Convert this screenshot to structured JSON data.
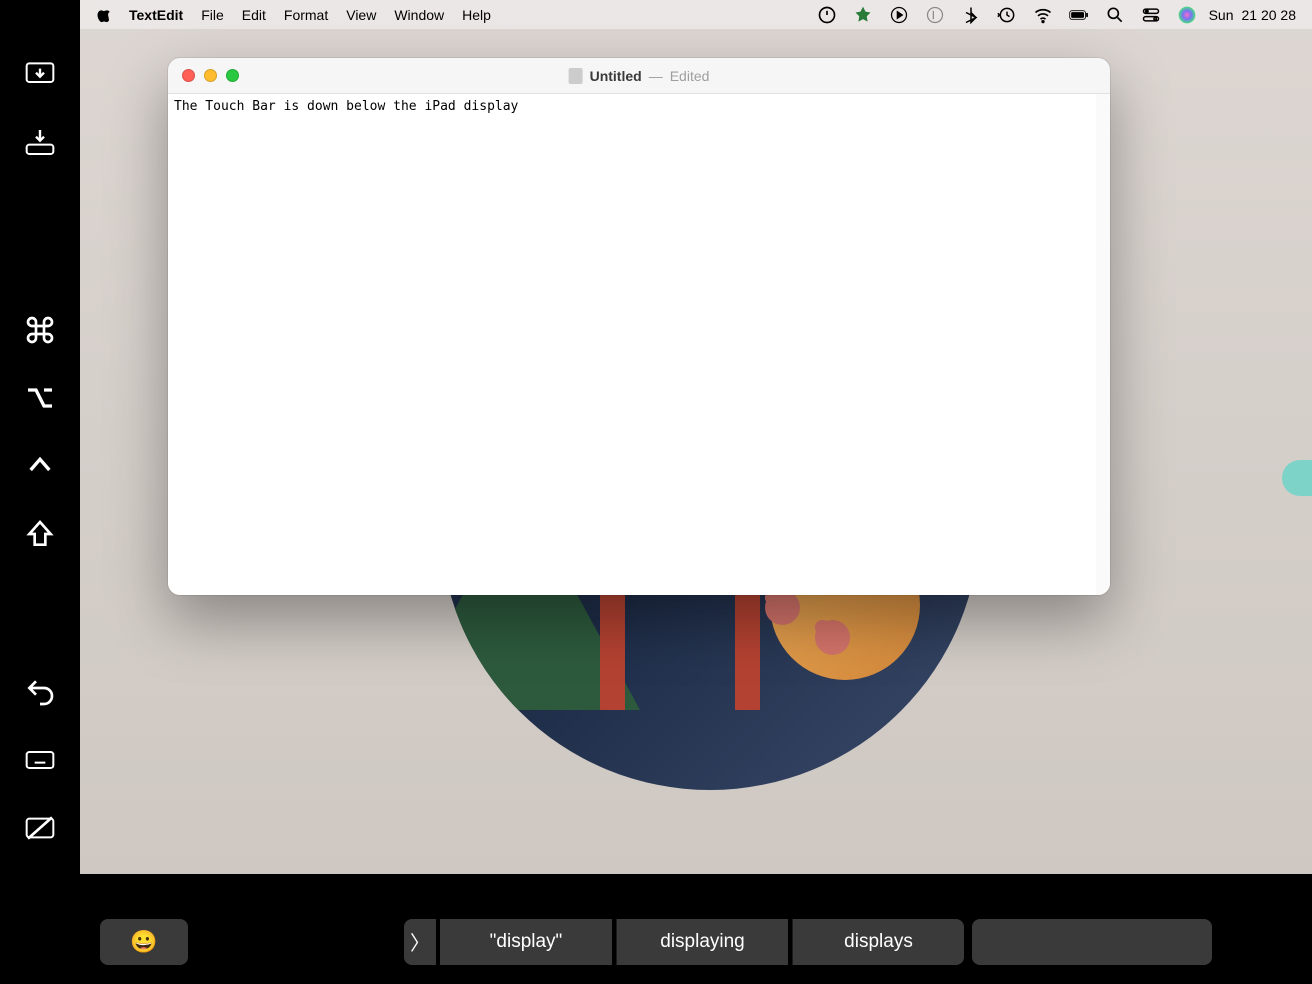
{
  "menubar": {
    "app_name": "TextEdit",
    "items": [
      "File",
      "Edit",
      "Format",
      "View",
      "Window",
      "Help"
    ],
    "clock_day": "Sun",
    "clock_time": "21 20 28"
  },
  "window": {
    "title": "Untitled",
    "status_separator": "—",
    "status": "Edited",
    "document_text": "The Touch Bar is down below the iPad display"
  },
  "touchbar": {
    "emoji": "😀",
    "chevron": "〉",
    "suggestions": [
      "\"display\"",
      "displaying",
      "displays"
    ]
  },
  "sidebar_icons": [
    "screen-down-icon",
    "tray-down-icon",
    "command-icon",
    "option-icon",
    "control-icon",
    "shift-icon",
    "undo-icon",
    "keyboard-icon",
    "screen-off-icon"
  ]
}
